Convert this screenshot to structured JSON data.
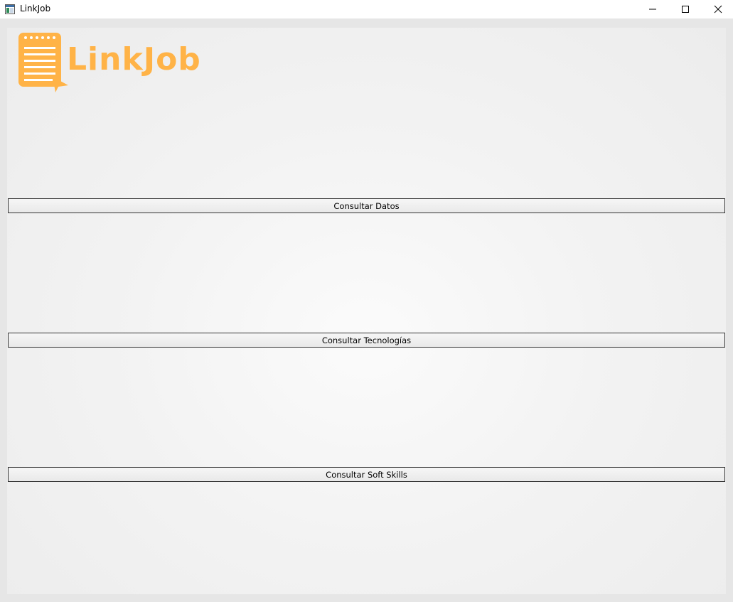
{
  "window": {
    "title": "LinkJob",
    "icon": "app-window-icon",
    "controls": [
      "minimize-icon",
      "maximize-icon",
      "close-icon"
    ]
  },
  "logo": {
    "text": "LinkJob",
    "icon": "document-cursor-icon",
    "color": "#ffb347"
  },
  "buttons": {
    "consultar_datos": "Consultar Datos",
    "consultar_tecnologias": "Consultar Tecnologías",
    "consultar_soft_skills": "Consultar Soft Skills"
  }
}
